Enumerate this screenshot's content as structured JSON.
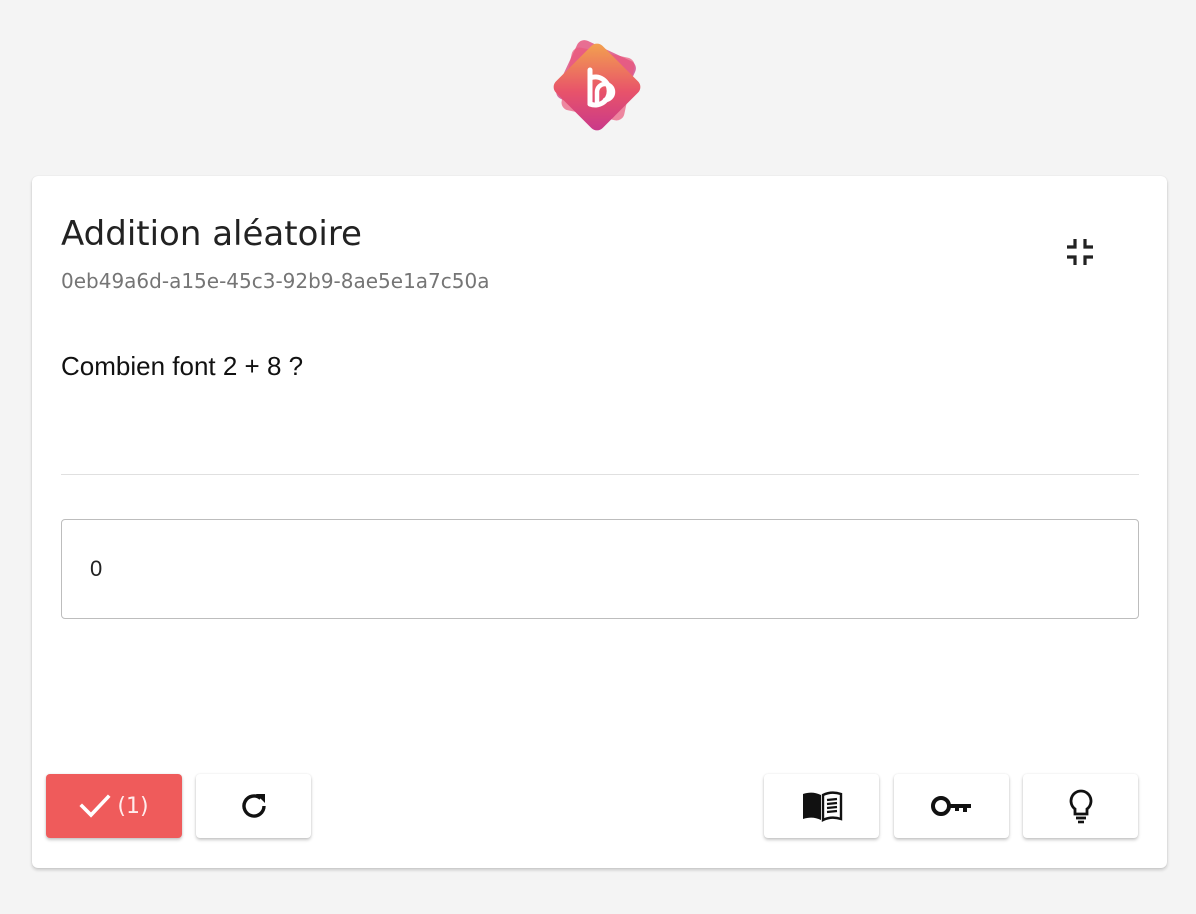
{
  "brand": {
    "logo_icon": "platon-logo-icon",
    "gradient": [
      "#f0a24a",
      "#e84a6a",
      "#c93a8a"
    ]
  },
  "exercise": {
    "title": "Addition aléatoire",
    "id": "0eb49a6d-a15e-45c3-92b9-8ae5e1a7c50a",
    "question": "Combien font 2 + 8 ?",
    "answer_value": "0"
  },
  "toolbar": {
    "collapse_icon": "collapse-icon",
    "submit_icon": "check-icon",
    "submit_count": "(1)",
    "reload_icon": "reload-icon",
    "statement_icon": "book-icon",
    "solution_icon": "key-icon",
    "hint_icon": "lightbulb-icon"
  },
  "colors": {
    "submit": "#ef5b5b",
    "background": "#f4f4f4"
  }
}
